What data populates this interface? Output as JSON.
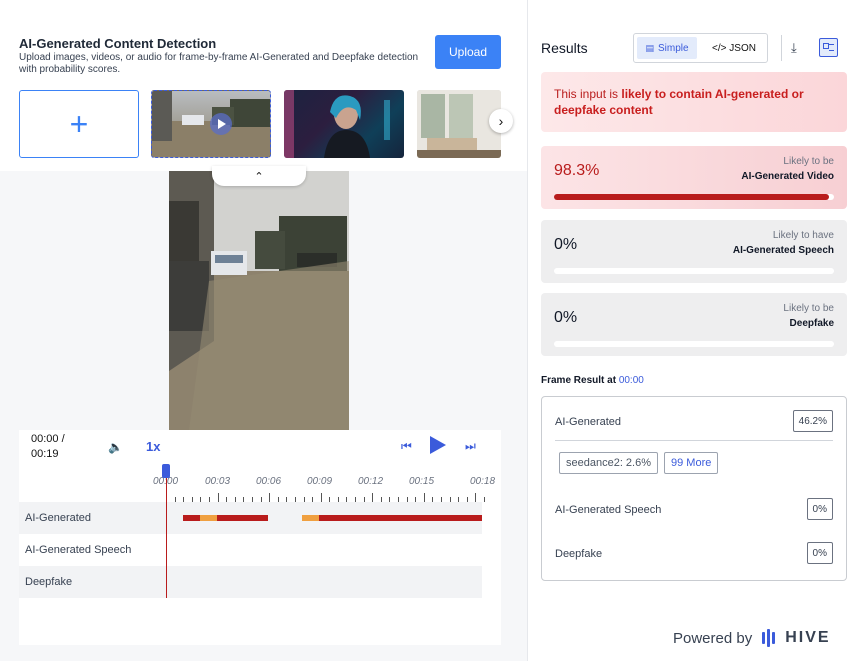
{
  "header": {
    "title": "AI-Generated Content Detection",
    "subtitle": "Upload images, videos, or audio for frame-by-frame AI-Generated and Deepfake detection with probability scores.",
    "upload_label": "Upload",
    "add_label": "+"
  },
  "player": {
    "time": "00:00 / 00:19",
    "speed": "1x",
    "ticks": [
      "00:00",
      "00:03",
      "00:06",
      "00:09",
      "00:12",
      "00:15",
      "00:18"
    ],
    "tracks": [
      "AI-Generated",
      "AI-Generated Speech",
      "Deepfake"
    ]
  },
  "results": {
    "title": "Results",
    "toggle_simple": "Simple",
    "toggle_json": "</> JSON",
    "verdict_prefix": "This input is ",
    "verdict_bold": "likely to contain AI-generated or deepfake content",
    "cards": [
      {
        "pct": "98.3%",
        "line1": "Likely to be",
        "line2": "AI-Generated Video",
        "value": 0.983
      },
      {
        "pct": "0%",
        "line1": "Likely to have",
        "line2": "AI-Generated Speech",
        "value": 0
      },
      {
        "pct": "0%",
        "line1": "Likely to be",
        "line2": "Deepfake",
        "value": 0
      }
    ],
    "frame_prefix": "Frame Result at ",
    "frame_time": "00:00",
    "frame": {
      "ai_label": "AI-Generated",
      "ai_val": "46.2%",
      "chip1": "seedance2: 2.6%",
      "chip2": "99 More",
      "speech_label": "AI-Generated Speech",
      "speech_val": "0%",
      "deepfake_label": "Deepfake",
      "deepfake_val": "0%"
    }
  },
  "footer": {
    "powered_by": "Powered by",
    "brand": "HIVE"
  },
  "colors": {
    "accent": "#3b5bdb",
    "danger": "#b91c1c",
    "warn": "#f59e0b"
  }
}
